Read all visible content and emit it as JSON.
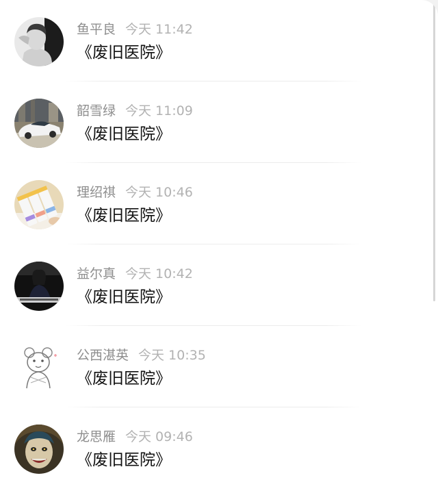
{
  "comments": [
    {
      "name": "鱼平良",
      "time": "今天 11:42",
      "text": "《废旧医院》",
      "avatar_icon": "portrait-bw-icon"
    },
    {
      "name": "韶雪绿",
      "time": "今天 11:09",
      "text": "《废旧医院》",
      "avatar_icon": "sports-car-icon"
    },
    {
      "name": "理绍祺",
      "time": "今天 10:46",
      "text": "《废旧医院》",
      "avatar_icon": "color-swatches-icon"
    },
    {
      "name": "益尔真",
      "time": "今天 10:42",
      "text": "《废旧医院》",
      "avatar_icon": "dark-portrait-icon"
    },
    {
      "name": "公西湛英",
      "time": "今天 10:35",
      "text": "《废旧医院》",
      "avatar_icon": "sketch-bear-icon"
    },
    {
      "name": "龙思雁",
      "time": "今天 09:46",
      "text": "《废旧医院》",
      "avatar_icon": "joker-face-icon"
    }
  ]
}
